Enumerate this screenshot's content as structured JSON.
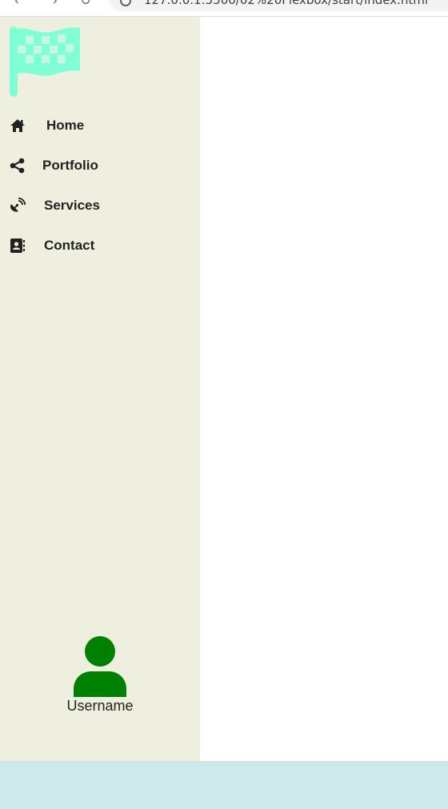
{
  "browser": {
    "url": "127.0.0.1:5500/02%20Flexbox/start/index.html",
    "back_glyph": "‹",
    "forward_glyph": "›",
    "reload_glyph": "↻",
    "icons": [
      "back-icon",
      "forward-icon",
      "reload-icon",
      "info-icon"
    ]
  },
  "sidebar": {
    "logo_icon": "checkered-flag-icon",
    "logo_color": "#7fffd4",
    "items": [
      {
        "label": "Home",
        "icon": "home-icon"
      },
      {
        "label": "Portfolio",
        "icon": "share-icon"
      },
      {
        "label": "Services",
        "icon": "satellite-dish-icon"
      },
      {
        "label": "Contact",
        "icon": "address-book-icon"
      }
    ],
    "user": {
      "name": "Username",
      "icon": "user-icon",
      "color": "#008000"
    }
  },
  "colors": {
    "sidebar_bg": "#eeefdf",
    "main_bg": "#ffffff",
    "footer_bg": "#cde9ec",
    "text": "#222222"
  }
}
